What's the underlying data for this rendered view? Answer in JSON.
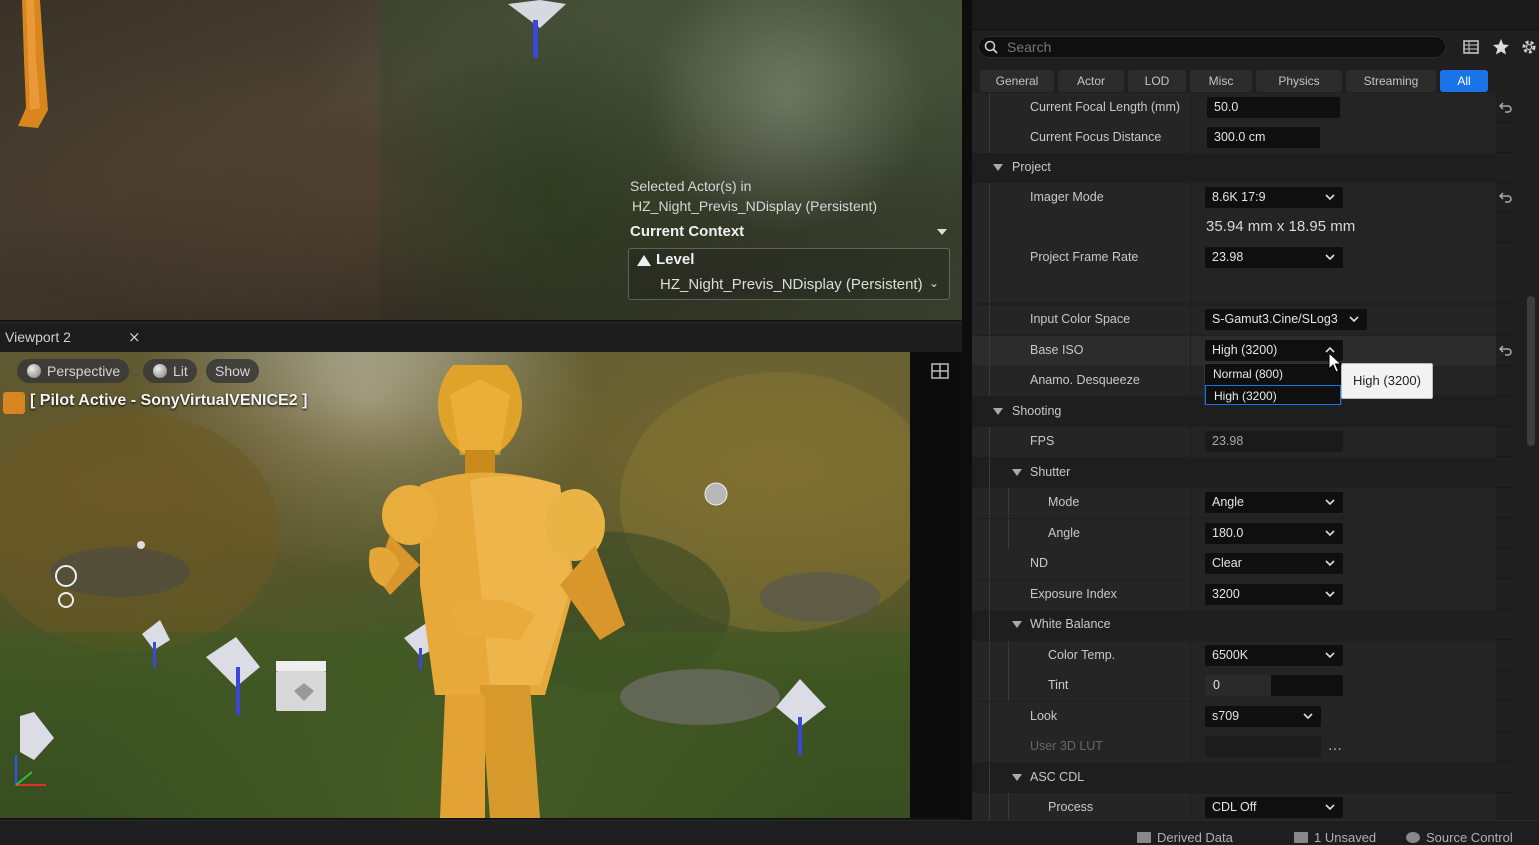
{
  "viewport_top": {
    "context_label_line1": "Selected Actor(s) in",
    "context_label_line2": "HZ_Night_Previs_NDisplay (Persistent)",
    "context_title": "Current Context",
    "level_label": "Level",
    "level_value": "HZ_Night_Previs_NDisplay (Persistent)"
  },
  "viewport2": {
    "tab_title": "Viewport 2",
    "close_glyph": "×",
    "perspective_label": "Perspective",
    "lit_label": "Lit",
    "show_label": "Show",
    "pilot_label": "[ Pilot Active - SonyVirtualVENICE2 ]"
  },
  "details": {
    "search_placeholder": "Search",
    "tabs": [
      "General",
      "Actor",
      "LOD",
      "Misc",
      "Physics",
      "Streaming",
      "All"
    ],
    "active_tab": "All",
    "rows": {
      "focal_length": {
        "label": "Current Focal Length (mm)",
        "value": "50.0"
      },
      "focus_distance": {
        "label": "Current Focus Distance",
        "value": "300.0 cm"
      },
      "project": {
        "label": "Project"
      },
      "imager_mode": {
        "label": "Imager Mode",
        "value": "8.6K 17:9"
      },
      "imager_size": {
        "value": "35.94 mm x 18.95 mm"
      },
      "frame_rate": {
        "label": "Project Frame Rate",
        "value": "23.98"
      },
      "color_space": {
        "label": "Input Color Space",
        "value": "S-Gamut3.Cine/SLog3"
      },
      "base_iso": {
        "label": "Base ISO",
        "value": "High (3200)"
      },
      "desqueeze": {
        "label": "Anamo. Desqueeze"
      },
      "shooting": {
        "label": "Shooting"
      },
      "fps": {
        "label": "FPS",
        "value": "23.98"
      },
      "shutter": {
        "label": "Shutter"
      },
      "shutter_mode": {
        "label": "Mode",
        "value": "Angle"
      },
      "shutter_angle": {
        "label": "Angle",
        "value": "180.0"
      },
      "nd": {
        "label": "ND",
        "value": "Clear"
      },
      "exposure_index": {
        "label": "Exposure Index",
        "value": "3200"
      },
      "white_balance": {
        "label": "White Balance"
      },
      "color_temp": {
        "label": "Color Temp.",
        "value": "6500K"
      },
      "tint": {
        "label": "Tint",
        "value": "0"
      },
      "look": {
        "label": "Look",
        "value": "s709"
      },
      "user_lut": {
        "label": "User 3D LUT",
        "value": ""
      },
      "asc_cdl": {
        "label": "ASC CDL"
      },
      "process": {
        "label": "Process",
        "value": "CDL Off"
      }
    },
    "tint_fraction": 0.48,
    "iso_menu": {
      "options": [
        "Normal (800)",
        "High (3200)"
      ],
      "selected": "High (3200)"
    },
    "tooltip": "High (3200)"
  },
  "statusbar": {
    "derived_data": "Derived Data",
    "unsaved": "1 Unsaved",
    "source_control": "Source Control"
  },
  "colors": {
    "accent": "#1a73e8",
    "pilot_icon": "#d88420"
  }
}
